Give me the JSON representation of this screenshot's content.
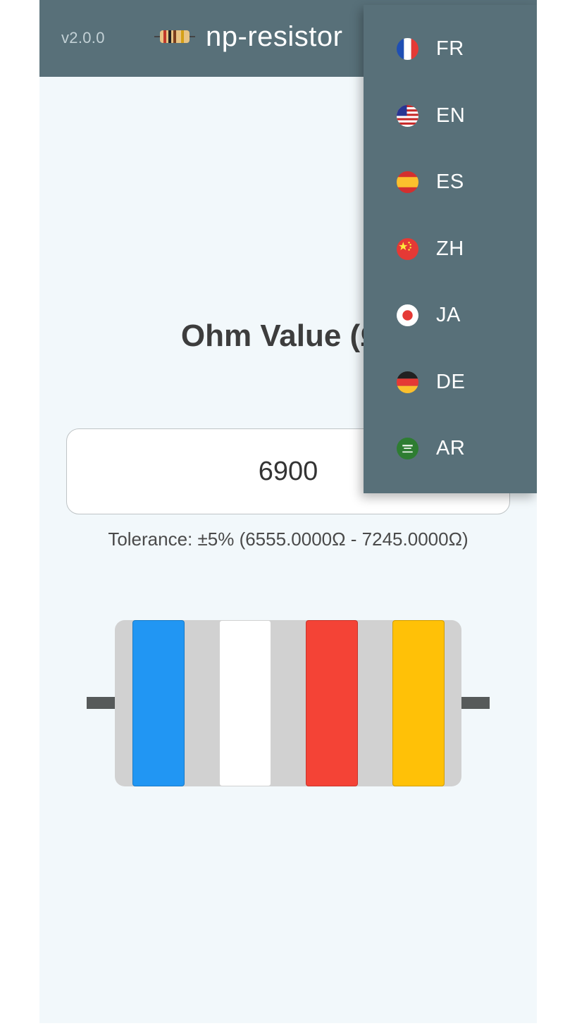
{
  "header": {
    "version": "v2.0.0",
    "title": "np-resistor"
  },
  "main": {
    "heading": "Ohm Value (Ω)",
    "input_value": "6900",
    "tolerance_text": "Tolerance: ±5% (6555.0000Ω - 7245.0000Ω)"
  },
  "resistor": {
    "body_color": "#d1d1d1",
    "lead_color": "#565a5a",
    "bands": [
      {
        "name": "blue",
        "color": "#2196f3"
      },
      {
        "name": "white",
        "color": "#ffffff"
      },
      {
        "name": "red",
        "color": "#f44336"
      },
      {
        "name": "gold",
        "color": "#ffc107"
      }
    ]
  },
  "language_menu": {
    "background": "#587079",
    "items": [
      {
        "code": "FR",
        "flag": "france-flag-icon"
      },
      {
        "code": "EN",
        "flag": "usa-flag-icon"
      },
      {
        "code": "ES",
        "flag": "spain-flag-icon"
      },
      {
        "code": "ZH",
        "flag": "china-flag-icon"
      },
      {
        "code": "JA",
        "flag": "japan-flag-icon"
      },
      {
        "code": "DE",
        "flag": "germany-flag-icon"
      },
      {
        "code": "AR",
        "flag": "saudi-arabia-flag-icon"
      }
    ]
  }
}
